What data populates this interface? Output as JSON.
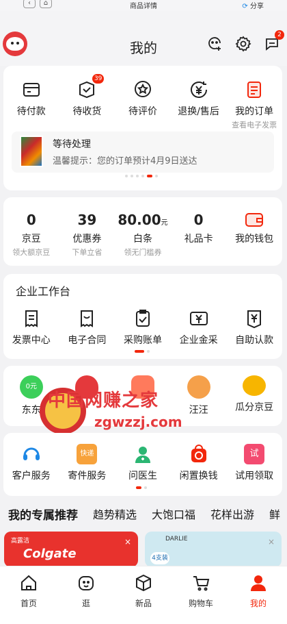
{
  "statusbar": {
    "title": "商品详情",
    "share": "分享"
  },
  "header": {
    "title": "我的",
    "message_count": "2"
  },
  "orders": {
    "items": [
      {
        "label": "待付款",
        "badge": ""
      },
      {
        "label": "待收货",
        "badge": "39"
      },
      {
        "label": "待评价",
        "badge": ""
      },
      {
        "label": "退换/售后",
        "badge": ""
      },
      {
        "label": "我的订单",
        "badge": "",
        "sub": "查看电子发票"
      }
    ],
    "notice": {
      "title": "等待处理",
      "text": "温馨提示：您的订单预计4月9日送达"
    }
  },
  "assets": {
    "items": [
      {
        "value": "0",
        "unit": "",
        "label": "京豆",
        "sub": "领大额京豆"
      },
      {
        "value": "39",
        "unit": "",
        "label": "优惠券",
        "sub": "下单立省"
      },
      {
        "value": "80.00",
        "unit": "元",
        "label": "白条",
        "sub": "领无门槛券"
      },
      {
        "value": "0",
        "unit": "",
        "label": "礼品卡",
        "sub": ""
      },
      {
        "value": "",
        "unit": "",
        "label": "我的钱包",
        "sub": ""
      }
    ]
  },
  "enterprise": {
    "title": "企业工作台",
    "items": [
      {
        "label": "发票中心"
      },
      {
        "label": "电子合同"
      },
      {
        "label": "采购账单"
      },
      {
        "label": "企业金采"
      },
      {
        "label": "自助认款"
      }
    ]
  },
  "games": {
    "items": [
      {
        "label": "东东"
      },
      {
        "label": ""
      },
      {
        "label": ""
      },
      {
        "label": "汪汪"
      },
      {
        "label": "瓜分京豆"
      }
    ]
  },
  "services": {
    "items": [
      {
        "label": "客户服务"
      },
      {
        "label": "寄件服务",
        "tag": "快递"
      },
      {
        "label": "问医生"
      },
      {
        "label": "闲置换钱"
      },
      {
        "label": "试用领取",
        "tag": "试"
      }
    ]
  },
  "watermark": {
    "line1": "中国网赚之家",
    "line2": "zgwzzj.com"
  },
  "recommend": {
    "tabs": [
      "我的专属推荐",
      "趋势精选",
      "大饱口福",
      "花样出游",
      "鲜"
    ]
  },
  "products": [
    {
      "brand": "Colgate",
      "maker": "高露洁"
    },
    {
      "brand": "DARLIE",
      "tag": "4支装"
    }
  ],
  "tabbar": {
    "items": [
      "首页",
      "逛",
      "新品",
      "购物车",
      "我的"
    ]
  },
  "colors": {
    "accent": "#f2270c",
    "bg": "#f2f2f4"
  }
}
